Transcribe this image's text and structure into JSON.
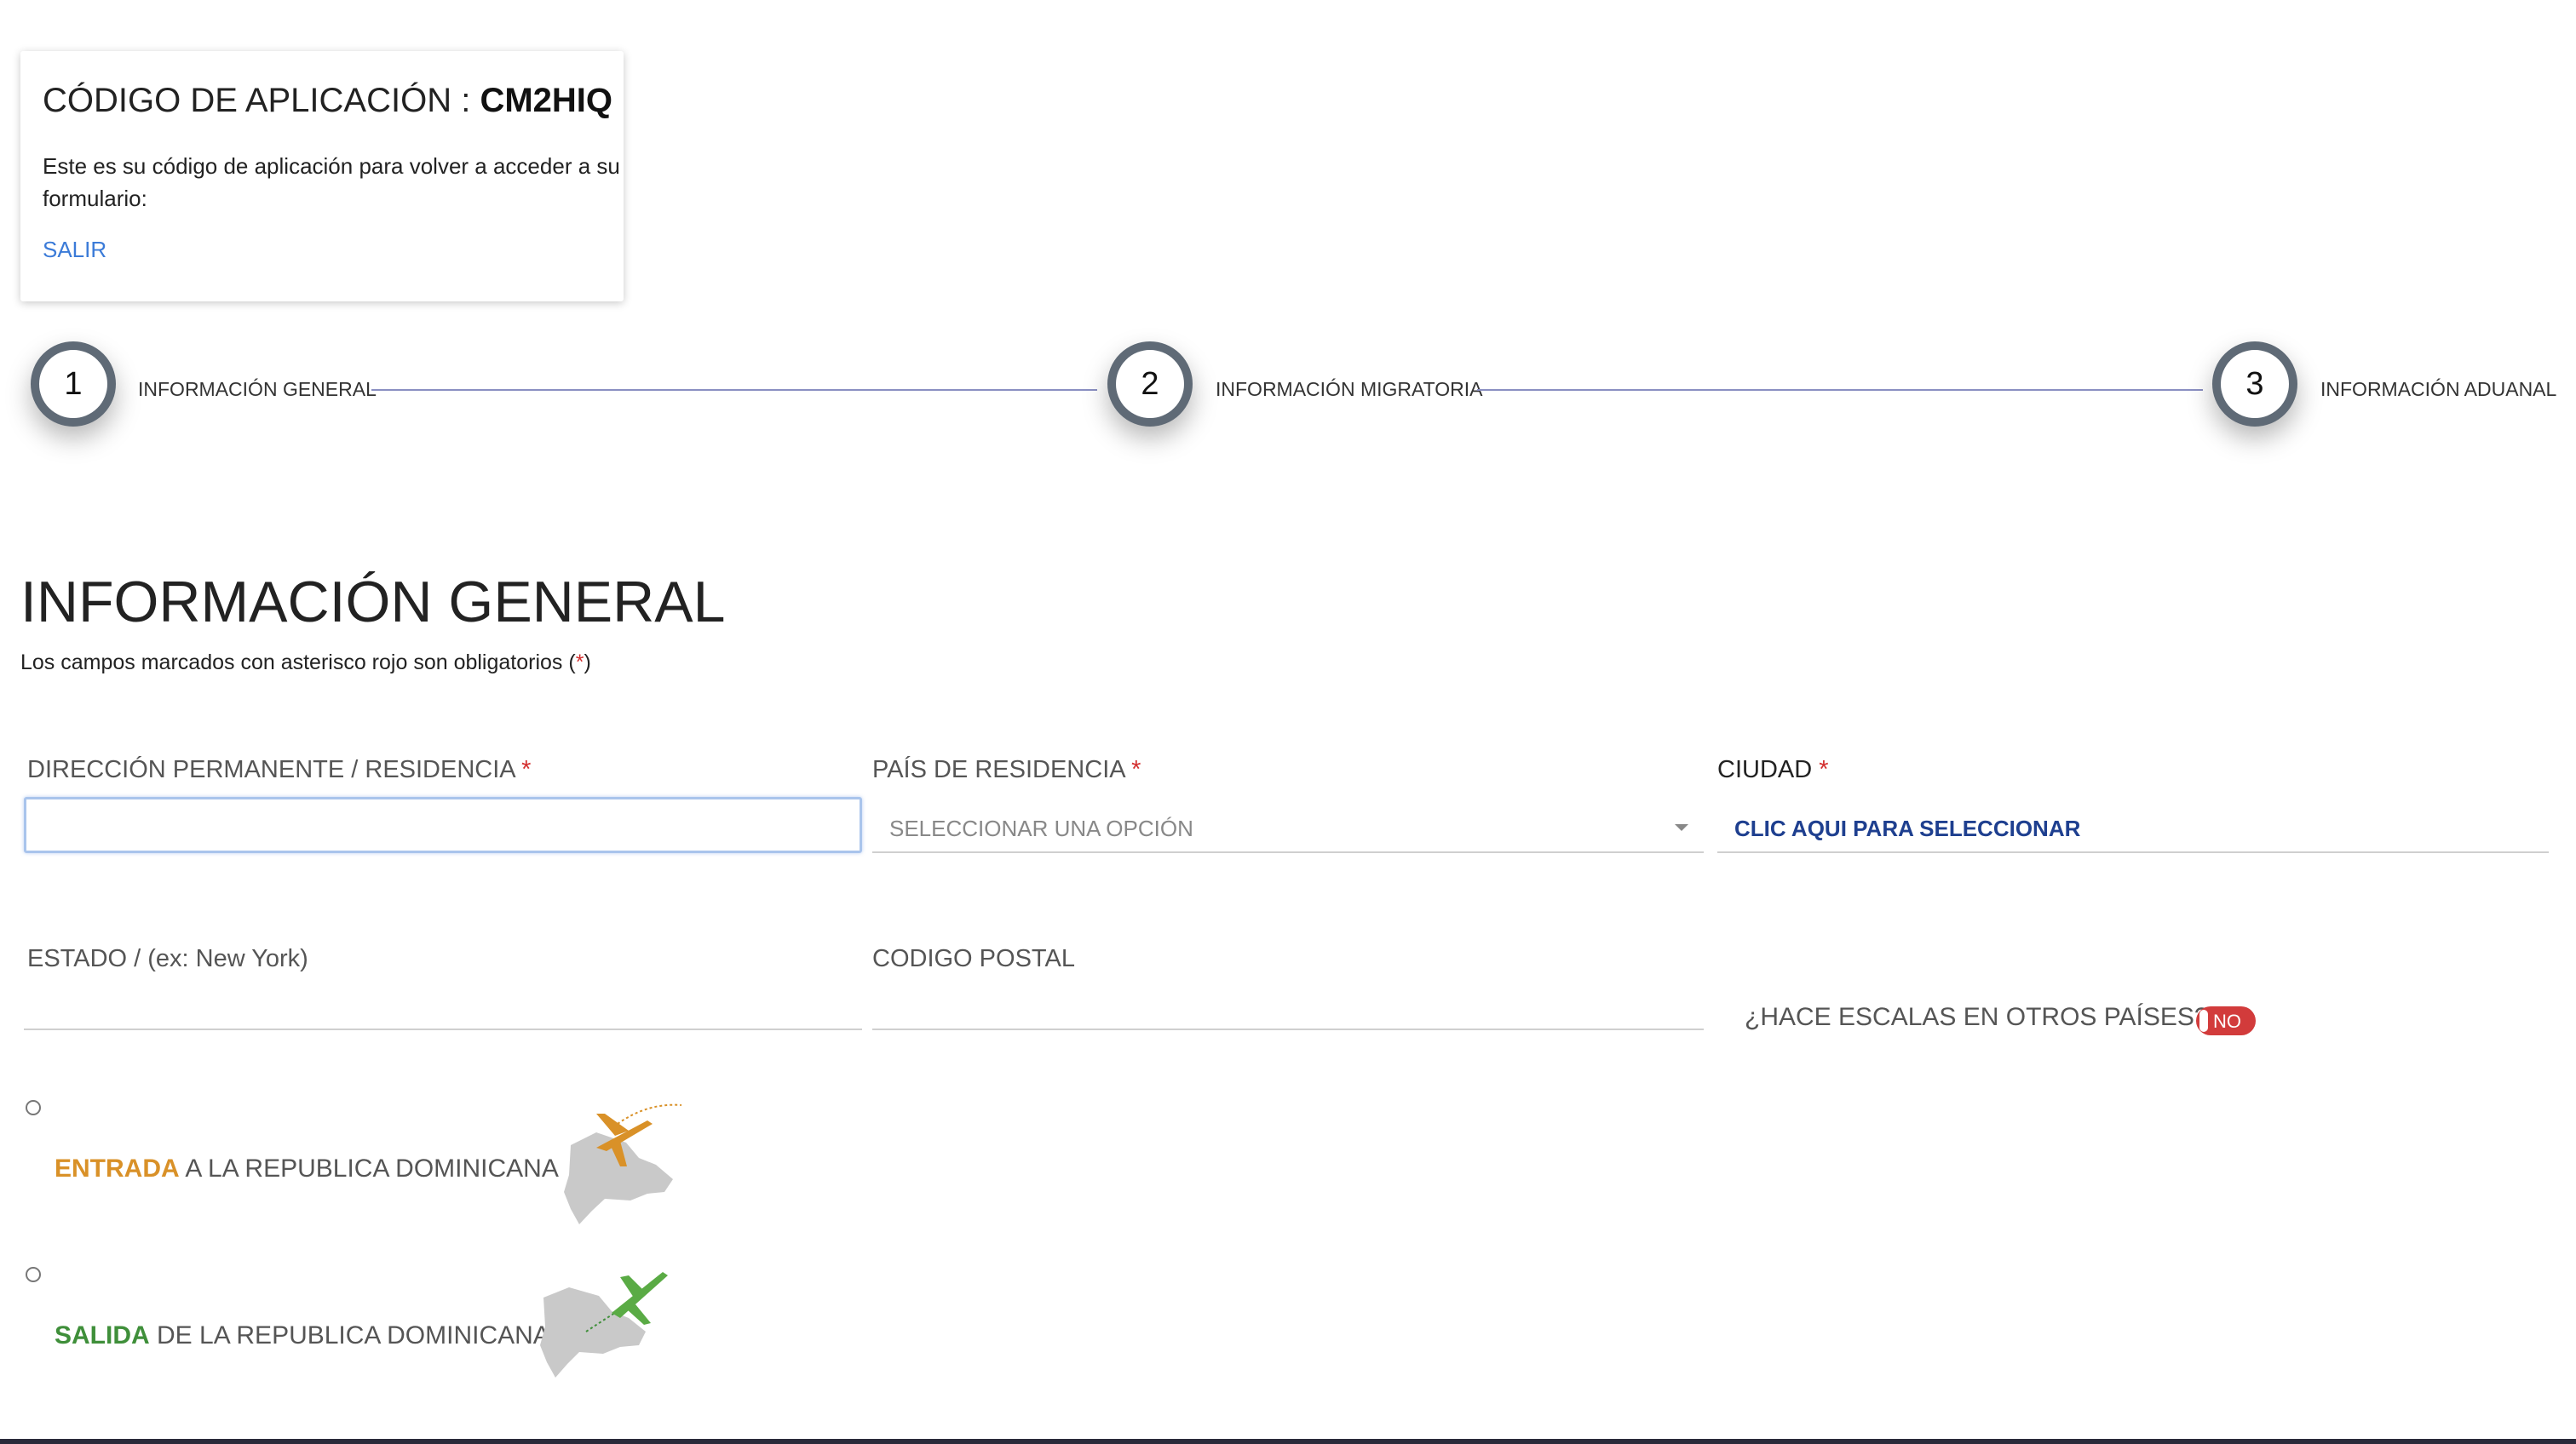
{
  "code_card": {
    "title_prefix": "CÓDIGO DE APLICACIÓN : ",
    "code": "CM2HIQ",
    "description": "Este es su código de aplicación para volver a acceder a su formulario:",
    "exit_link": "SALIR"
  },
  "stepper": {
    "steps": [
      {
        "number": "1",
        "label": "INFORMACIÓN GENERAL"
      },
      {
        "number": "2",
        "label": "INFORMACIÓN MIGRATORIA"
      },
      {
        "number": "3",
        "label": "INFORMACIÓN ADUANAL"
      }
    ]
  },
  "section": {
    "title": "INFORMACIÓN GENERAL",
    "note_prefix": "Los campos marcados con asterisco rojo son obligatorios (",
    "note_asterisk": "*",
    "note_suffix": ")"
  },
  "form": {
    "address": {
      "label": "DIRECCIÓN PERMANENTE / RESIDENCIA",
      "required": "*",
      "value": ""
    },
    "country": {
      "label": "PAÍS DE RESIDENCIA",
      "required": "*",
      "placeholder": "SELECCIONAR UNA OPCIÓN"
    },
    "city": {
      "label": "CIUDAD",
      "required": "*",
      "action": "CLIC AQUI PARA SELECCIONAR"
    },
    "state": {
      "label": "ESTADO / (ex: New York)",
      "value": ""
    },
    "postal": {
      "label": "CODIGO POSTAL",
      "value": ""
    },
    "stops": {
      "label": "¿HACE ESCALAS EN OTROS PAÍSES?",
      "toggle": "NO"
    }
  },
  "travel_direction": {
    "entry": {
      "highlight": "ENTRADA",
      "rest": " A LA REPUBLICA DOMINICANA",
      "icon": "plane-arriving-icon"
    },
    "exit": {
      "highlight": "SALIDA",
      "rest": " DE LA REPUBLICA DOMINICANA",
      "icon": "plane-departing-icon"
    }
  },
  "colors": {
    "entry": "#d99128",
    "exit": "#3f8f3a",
    "link": "#3b7bd8",
    "city_action": "#1e3f8f",
    "toggle_no": "#d23b3b",
    "step_ring": "#5f6a76",
    "required": "#d32f2f"
  }
}
